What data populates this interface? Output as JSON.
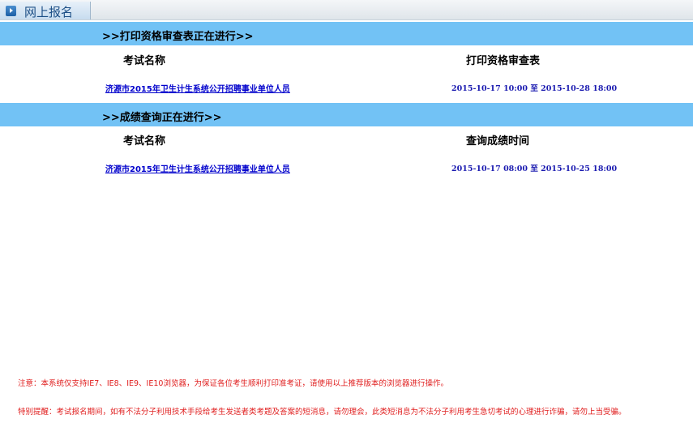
{
  "tab": {
    "icon": "arrow-right-icon",
    "label": "网上报名"
  },
  "print_section": {
    "title": ">>打印资格审查表正在进行>>",
    "col_name": "考试名称",
    "col_time": "打印资格审查表",
    "rows": [
      {
        "name": "济源市2015年卫生计生系统公开招聘事业单位人员",
        "time": "2015-10-17 10:00 至 2015-10-28 18:00"
      }
    ]
  },
  "score_section": {
    "title": ">>成绩查询正在进行>>",
    "col_name": "考试名称",
    "col_time": "查询成绩时间",
    "rows": [
      {
        "name": "济源市2015年卫生计生系统公开招聘事业单位人员",
        "time": "2015-10-17 08:00 至 2015-10-25 18:00"
      }
    ]
  },
  "notices": {
    "note": "注意：本系统仅支持IE7、IE8、IE9、IE10浏览器，为保证各位考生顺利打印准考证，请使用以上推荐版本的浏览器进行操作。",
    "warning": "特别提醒：考试报名期间，如有不法分子利用技术手段给考生发送者类考题及答案的短消息，请勿理会，此类短消息为不法分子利用考生急切考试的心理进行诈骗，请勿上当受骗。"
  },
  "colors": {
    "section_bar": "#72c2f5",
    "link": "#0000cc",
    "notice": "#e02020"
  }
}
